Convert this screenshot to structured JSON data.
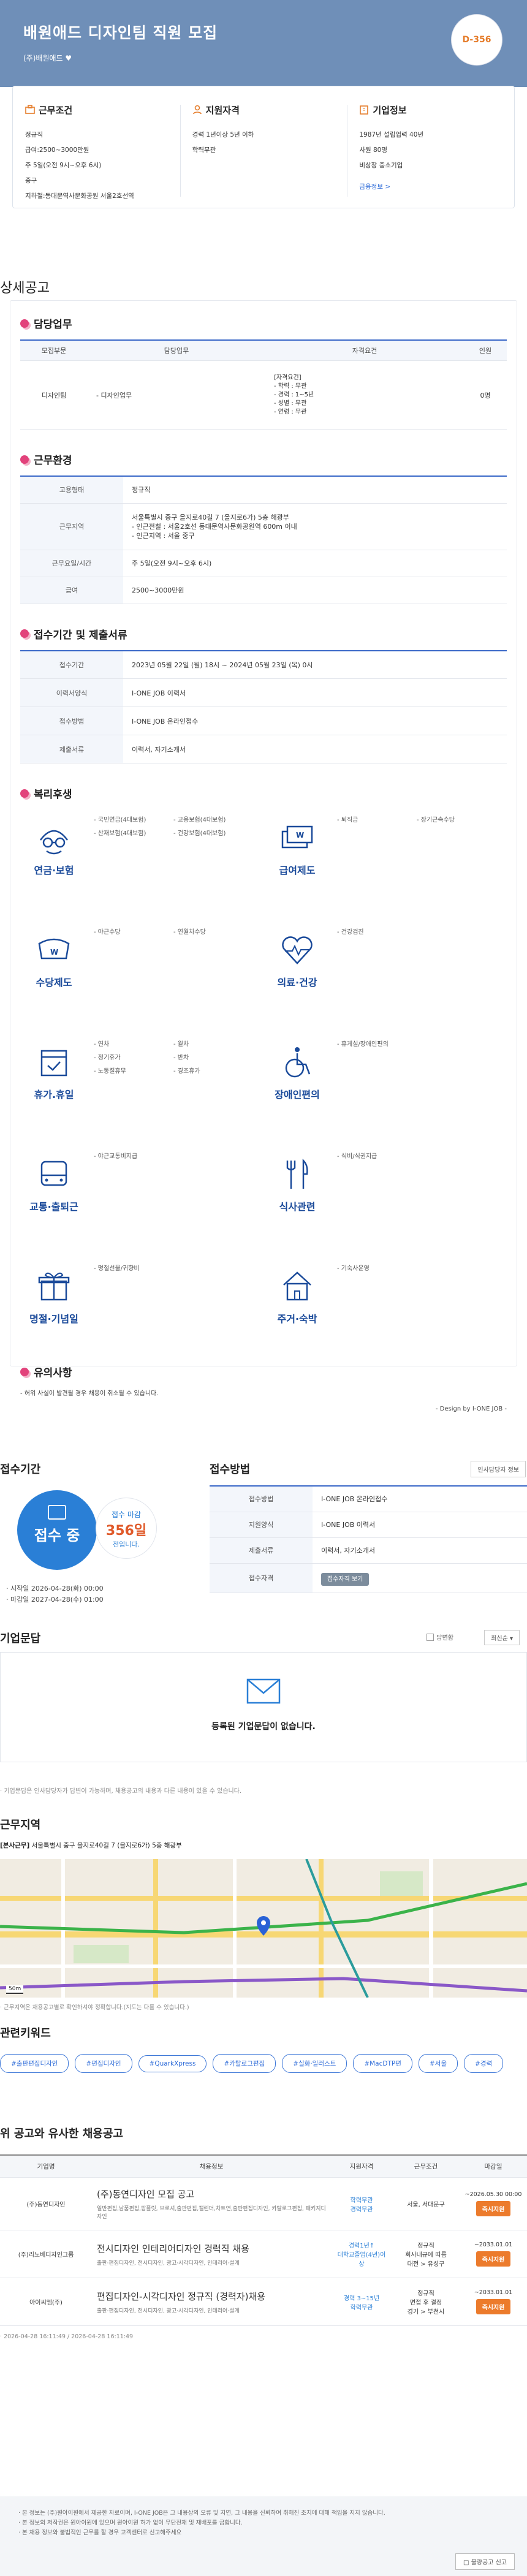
{
  "header": {
    "title": "배원애드 디자인팀 직원 모집",
    "company": "(주)배원애드",
    "dday": "D-356"
  },
  "summary": [
    {
      "title": "근무조건",
      "lines": [
        "정규직",
        "급여:2500~3000만원",
        "주 5일(오전 9시~오후 6시)",
        "중구",
        "지하철:동대문역사문화공원 서울2호선역"
      ]
    },
    {
      "title": "지원자격",
      "lines": [
        "경력 1년이상 5년 이하",
        "학력무관"
      ]
    },
    {
      "title": "기업정보",
      "lines": [
        "1987년 설립업력 40년",
        "사원 80명",
        "비상장 중소기업"
      ],
      "link": "금융정보 >"
    }
  ],
  "detail_title": "상세공고",
  "duty": {
    "title": "담당업무",
    "headers": [
      "모집부문",
      "담당업무",
      "자격요건",
      "인원"
    ],
    "row": [
      "디자인팀",
      "- 디자인업무",
      "[자격요건]\n- 학력 : 무관\n- 경력 : 1~5년\n- 성별 : 무관\n- 연령 : 무관",
      "0명"
    ]
  },
  "env": {
    "title": "근무환경",
    "rows": [
      [
        "고용형태",
        "정규직"
      ],
      [
        "근무지역",
        "서울특별시 중구 을지로40길 7 (을지로6가) 5층 해광부\n- 인근전철 : 서울2호선 동대문역사문화공원역 600m 이내\n- 인근지역 : 서울 중구"
      ],
      [
        "근무요일/시간",
        "주 5일(오전 9시~오후 6시)"
      ],
      [
        "급여",
        "2500~3000만원"
      ]
    ]
  },
  "apply": {
    "title": "접수기간 및 제출서류",
    "rows": [
      [
        "접수기간",
        "2023년 05월 22일 (월) 18시 ~ 2024년 05월 23일 (목) 0시"
      ],
      [
        "이력서양식",
        "I-ONE JOB 이력서"
      ],
      [
        "접수방법",
        "I-ONE JOB 온라인접수"
      ],
      [
        "제출서류",
        "이력서, 자기소개서"
      ]
    ]
  },
  "welfare": {
    "title": "복리후생",
    "groups": [
      {
        "name": "연금·보험",
        "items": [
          "국민연금(4대보험)",
          "고용보험(4대보험)",
          "산재보험(4대보험)",
          "건강보험(4대보험)"
        ]
      },
      {
        "name": "급여제도",
        "items": [
          "퇴직금",
          "장기근속수당"
        ]
      },
      {
        "name": "수당제도",
        "items": [
          "야근수당",
          "연월차수당"
        ]
      },
      {
        "name": "의료·건강",
        "items": [
          "건강검진"
        ]
      },
      {
        "name": "휴가.휴일",
        "items": [
          "연차",
          "월차",
          "정기휴가",
          "반차",
          "노동절휴무",
          "경조휴가"
        ]
      },
      {
        "name": "장애인편의",
        "items": [
          "휴게실/장애인편의"
        ]
      },
      {
        "name": "교통·출퇴근",
        "items": [
          "야근교통비지급"
        ]
      },
      {
        "name": "식사관련",
        "items": [
          "식비/식권지급"
        ]
      },
      {
        "name": "명절·기념일",
        "items": [
          "명절선물/귀향비"
        ]
      },
      {
        "name": "주거·숙박",
        "items": [
          "기숙사운영"
        ]
      }
    ]
  },
  "notice": {
    "title": "유의사항",
    "text": "- 허위 사실이 발견될 경우 채용이 취소될 수 있습니다.",
    "design": "- Design by I-ONE JOB -"
  },
  "period": {
    "title": "접수기간",
    "status": "접수 중",
    "left_label": "접수 마감",
    "left_days": "356일",
    "left_suffix": "전입니다.",
    "start": "· 시작일 2026-04-28(화) 00:00",
    "end": "· 마감일 2027-04-28(수) 01:00"
  },
  "method": {
    "title": "접수방법",
    "link": "인사담당자 정보",
    "rows": [
      [
        "접수방법",
        "I-ONE JOB 온라인접수"
      ],
      [
        "지원양식",
        "I-ONE JOB 이력서"
      ],
      [
        "제출서류",
        "이력서, 자기소개서"
      ],
      [
        "접수자격",
        ""
      ]
    ],
    "btn": "접수자격 보기"
  },
  "qa": {
    "title": "기업문답",
    "answered": "답변함",
    "sort": "최신순",
    "empty": "등록된 기업문답이 없습니다.",
    "note": "· 기업문답은 인사담당자가 답변이 가능하며, 채용공고의 내용과 다른 내용이 있을 수 있습니다."
  },
  "location": {
    "title": "근무지역",
    "addr_lbl": "[본사근무]",
    "addr": "서울특별시 중구 을지로40길 7 (을지로6가) 5층 해광부",
    "note": "· 근무지역은 채용공고별로 확인하셔야 정확합니다.(지도는 다를 수 있습니다.)",
    "scale": "50m"
  },
  "keywords": {
    "title": "관련키워드",
    "items": [
      "#출판편집디자인",
      "#편집디자인",
      "#QuarkXpress",
      "#카탈로그편집",
      "#실화·일러스트",
      "#MacDTP편",
      "#서울",
      "#경력"
    ]
  },
  "similar": {
    "title": "위 공고와 유사한 채용공고",
    "headers": [
      "기업명",
      "채용정보",
      "지원자격",
      "근무조건",
      "마감일"
    ],
    "rows": [
      [
        "(주)동연디자인",
        "(주)동연디자인 모집 공고",
        "일반편집,남품편집,팜플릿, 브로셔,출판편집,캘린더,차트연,출판편집디자인, 카탈로그편집, 패키지디자인",
        "학력무관\n경력무관",
        "서울, 서대문구",
        "~2026.05.30 00:00",
        "즉시지원"
      ],
      [
        "(주)리노베디자인그룹",
        "전시디자인 인테리어디자인 경력직 채용",
        "출판·편집디자인, 전시디자인, 광고·시각디자인, 인테리어·설계",
        "경력1년↑\n대학교졸업(4년)이상",
        "정규직\n회사내규에 따름\n대전 > 유성구",
        "~2033.01.01",
        "즉시지원"
      ],
      [
        "아이씨엠(주)",
        "편집디자인-시각디자인 정규직 (경력자)채용",
        "출판·편집디자인, 전시디자인, 광고·시각디자인, 인테리어·설계",
        "경력 3~15년\n학력무관",
        "정규직\n면접 후 결정\n경기 > 부천시",
        "~2033.01.01",
        "즉시지원"
      ]
    ],
    "meta": "· 2026-04-28 16:11:49 / 2026-04-28 16:11:49"
  },
  "foot": {
    "lines": [
      "· 본 정보는 (주)원아이원에서 제공한 자료이며, I-ONE JOB은 그 내용상의 오류 및 지연, 그 내용을 신뢰하여 취해진 조치에 대해 책임을 지지 않습니다.",
      "· 본 정보의 저작권은 원아이원에 있으며 원아이원 허가 없이 무단전재 및 재배포를 금합니다.",
      "· 본 채용 정보와 불법적인 근무를 할 경우 고객센터로 신고해주세요"
    ],
    "report": "불량공고 신고"
  }
}
